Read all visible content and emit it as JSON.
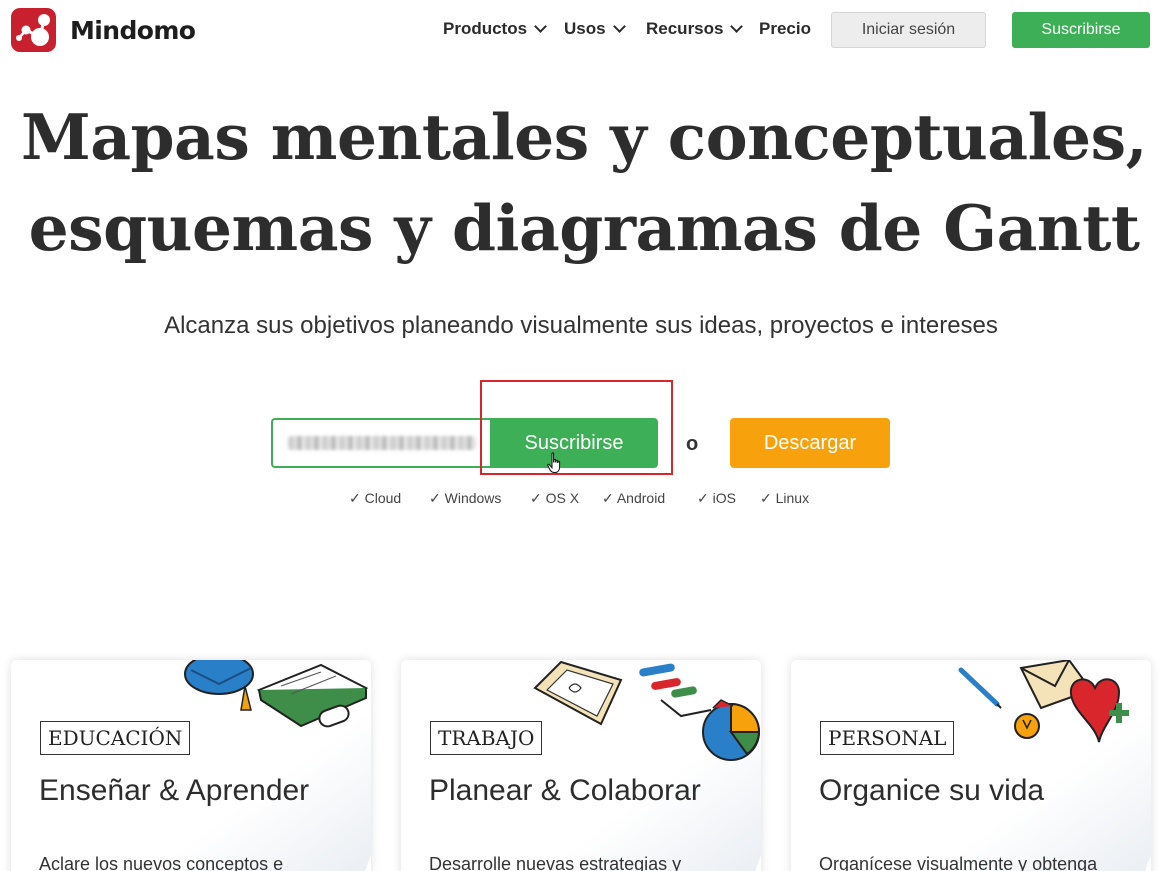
{
  "header": {
    "logo_text": "Mindomo",
    "nav": [
      {
        "label": "Productos",
        "has_dropdown": true
      },
      {
        "label": "Usos",
        "has_dropdown": true
      },
      {
        "label": "Recursos",
        "has_dropdown": true
      },
      {
        "label": "Precio",
        "has_dropdown": false
      }
    ],
    "login_label": "Iniciar sesión",
    "subscribe_label": "Suscribirse"
  },
  "hero": {
    "title_line1": "Mapas mentales y conceptuales,",
    "title_line2": "esquemas y diagramas de Gantt",
    "subtitle": "Alcanza sus objetivos planeando visualmente sus ideas, proyectos e intereses",
    "subscribe_label": "Suscribirse",
    "or_text": "o",
    "download_label": "Descargar",
    "platforms": [
      "✓ Cloud",
      "✓ Windows",
      "✓ OS X",
      "✓ Android",
      "✓ iOS",
      "✓ Linux"
    ]
  },
  "cards": [
    {
      "tag": "EDUCACIÓN",
      "title": "Enseñar & Aprender",
      "desc": "Aclare los nuevos conceptos e"
    },
    {
      "tag": "TRABAJO",
      "title": "Planear & Colaborar",
      "desc": "Desarrolle nuevas estrategias y"
    },
    {
      "tag": "PERSONAL",
      "title": "Organice su vida",
      "desc": "Organícese visualmente y obtenga"
    }
  ],
  "colors": {
    "brand_red": "#c8202f",
    "green": "#3daf57",
    "orange": "#f7a20c",
    "highlight_red": "#d9262c"
  }
}
